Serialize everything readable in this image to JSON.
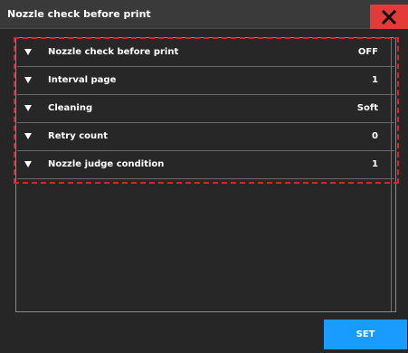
{
  "window": {
    "title": "Nozzle check before print",
    "close_icon": "close-x-icon"
  },
  "settings": [
    {
      "label": "Nozzle check before print",
      "value": "OFF"
    },
    {
      "label": "Interval page",
      "value": "1"
    },
    {
      "label": "Cleaning",
      "value": "Soft"
    },
    {
      "label": "Retry count",
      "value": "0"
    },
    {
      "label": "Nozzle judge condition",
      "value": "1"
    }
  ],
  "footer": {
    "set_label": "SET"
  },
  "colors": {
    "close_button": "#e33a3a",
    "set_button": "#1a9bff",
    "highlight_border": "#e0202a"
  }
}
